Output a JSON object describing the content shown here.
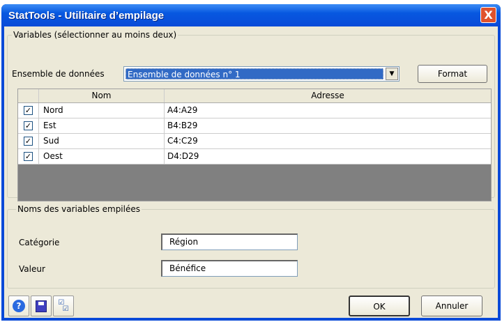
{
  "window": {
    "title": "StatTools - Utilitaire d’empilage",
    "close_label": "X"
  },
  "variables_group": {
    "legend": "Variables (sélectionner au moins deux)",
    "dataset_label": "Ensemble de données",
    "dataset_value": "Ensemble de données n° 1",
    "format_button": "Format",
    "columns": [
      "Nom",
      "Adresse"
    ],
    "rows": [
      {
        "checked": true,
        "name": "Nord",
        "address": "A4:A29"
      },
      {
        "checked": true,
        "name": "Est",
        "address": "B4:B29"
      },
      {
        "checked": true,
        "name": "Sud",
        "address": "C4:C29"
      },
      {
        "checked": true,
        "name": "Oest",
        "address": "D4:D29"
      }
    ]
  },
  "names_group": {
    "legend": "Noms des variables empilées",
    "category_label": "Catégorie",
    "category_value": "Région",
    "value_label": "Valeur",
    "value_value": "Bénéfice"
  },
  "footer": {
    "ok": "OK",
    "cancel": "Annuler"
  }
}
